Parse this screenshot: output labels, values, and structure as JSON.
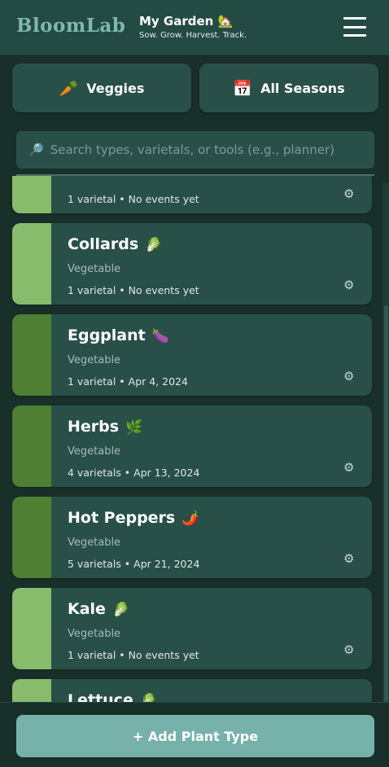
{
  "header": {
    "logo": "BloomLab",
    "garden_title": "My Garden 🏡",
    "garden_subtitle": "Sow. Grow. Harvest. Track."
  },
  "filters": {
    "type": {
      "icon": "🥕",
      "label": "Veggies"
    },
    "season": {
      "icon": "📅",
      "label": "All Seasons"
    }
  },
  "search": {
    "icon": "🔎",
    "placeholder": "Search types, varietals, or tools (e.g., planner)"
  },
  "plants": [
    {
      "name": "",
      "emoji": "",
      "category": "",
      "meta": "1 varietal • No events yet",
      "bar_color": "#88bb6c"
    },
    {
      "name": "Collards",
      "emoji": "🥬",
      "category": "Vegetable",
      "meta": "1 varietal • No events yet",
      "bar_color": "#88bb6c"
    },
    {
      "name": "Eggplant",
      "emoji": "🍆",
      "category": "Vegetable",
      "meta": "1 varietal • Apr 4, 2024",
      "bar_color": "#4f7f32"
    },
    {
      "name": "Herbs",
      "emoji": "🌿",
      "category": "Vegetable",
      "meta": "4 varietals • Apr 13, 2024",
      "bar_color": "#4f7f32"
    },
    {
      "name": "Hot Peppers",
      "emoji": "🌶️",
      "category": "Vegetable",
      "meta": "5 varietals • Apr 21, 2024",
      "bar_color": "#4f7f32"
    },
    {
      "name": "Kale",
      "emoji": "🥬",
      "category": "Vegetable",
      "meta": "1 varietal • No events yet",
      "bar_color": "#88bb6c"
    },
    {
      "name": "Lettuce",
      "emoji": "🥬",
      "category": "",
      "meta": "",
      "bar_color": "#88bb6c"
    }
  ],
  "settings_icon": "⚙",
  "add_button": "+ Add Plant Type"
}
